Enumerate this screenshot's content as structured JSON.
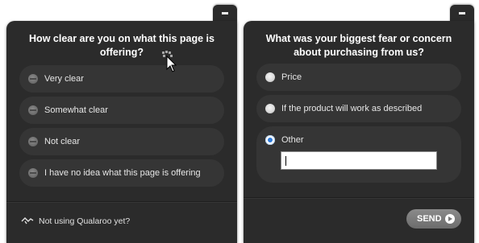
{
  "left_survey": {
    "question": "How clear are you on what this page is offering?",
    "options": [
      {
        "label": "Very clear"
      },
      {
        "label": "Somewhat clear"
      },
      {
        "label": "Not clear"
      },
      {
        "label": "I have no idea what this page is offering"
      }
    ],
    "footer_text": "Not using Qualaroo yet?",
    "minimize_icon": "minus-icon",
    "footer_icon": "qualaroo-logo-icon"
  },
  "right_survey": {
    "question": "What was your biggest fear or concern about purchasing from us?",
    "options": [
      {
        "label": "Price",
        "selected": false
      },
      {
        "label": "If the product will work as described",
        "selected": false
      },
      {
        "label": "Other",
        "selected": true
      }
    ],
    "other_input_value": "",
    "send_label": "SEND",
    "minimize_icon": "minus-icon",
    "send_icon": "arrow-right-circle-icon"
  },
  "colors": {
    "panel_bg": "#2b2b2b",
    "option_bg": "#353535",
    "selected_radio": "#2f7bd9",
    "send_button": "#7a7a7a"
  }
}
